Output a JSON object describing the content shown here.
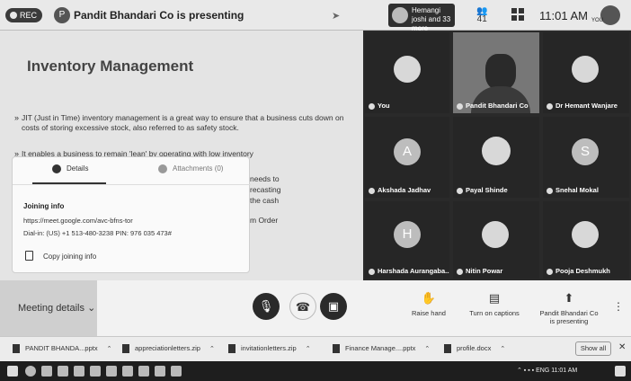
{
  "topbar": {
    "rec_label": "REC",
    "presenter_initial": "P",
    "presenting_title": "Pandit Bhandari Co is presenting",
    "people_chip_text": "Hemangi joshi and 33 more",
    "participant_count": "41",
    "time": "11:01 AM",
    "self_label": "YOU"
  },
  "slide": {
    "title": "Inventory Management",
    "bullet1": "JIT (Just in Time) inventory management is a great way to ensure that a business cuts down on costs of storing excessive stock, also referred to as safety stock.",
    "bullet2": "It enables a business to remain 'lean' by operating with low inventory",
    "frag1": "needs to",
    "frag2": "recasting",
    "frag3": "the cash",
    "frag4": "m  Order"
  },
  "popup": {
    "tab_details": "Details",
    "tab_attachments": "Attachments (0)",
    "joining_title": "Joining info",
    "link": "https://meet.google.com/avc-bfns-tor",
    "dial": "Dial-in: (US) +1 513-480-3238  PIN: 976 035 473#",
    "copy_label": "Copy joining info"
  },
  "tiles": {
    "you": "You",
    "featured": "Pandit Bhandari Co",
    "hemant": "Dr Hemant Wanjare",
    "akshada": "Akshada Jadhav",
    "akshada_initial": "A",
    "payal": "Payal Shinde",
    "snehal": "Snehal Mokal",
    "snehal_initial": "S",
    "harshada": "Harshada Aurangaba...",
    "harshada_initial": "H",
    "nitin": "Nitin Powar",
    "pooja": "Pooja Deshmukh"
  },
  "controls": {
    "meeting_details": "Meeting details",
    "raise_hand": "Raise hand",
    "captions": "Turn on captions",
    "presenting": "Pandit Bhandari Co is presenting"
  },
  "downloads": {
    "file1": "PANDIT BHANDA...pptx",
    "file2": "appreciationletters.zip",
    "file3": "invitationletters.zip",
    "file4": "Finance Manage....pptx",
    "file5": "profile.docx",
    "show_all": "Show all"
  },
  "taskbar": {
    "tray_text": "ENG  11:01 AM"
  }
}
